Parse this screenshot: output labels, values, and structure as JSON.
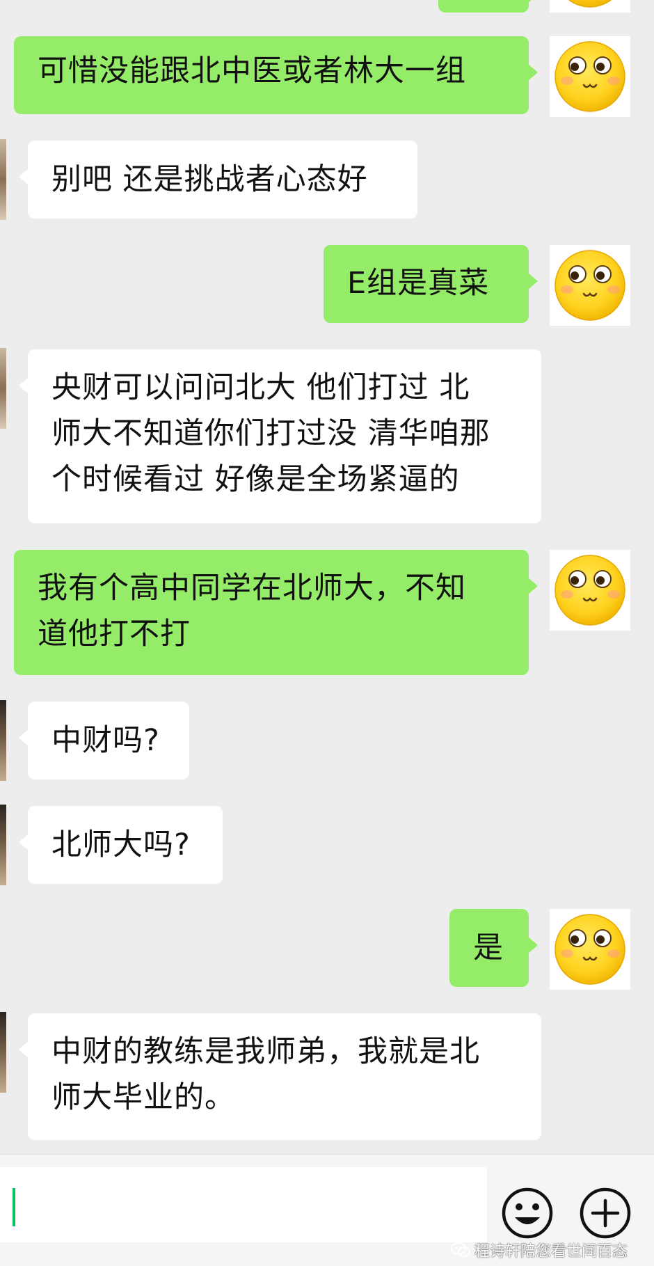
{
  "messages": [
    {
      "side": "sent",
      "text": "可惜没能跟北中医或者林大一组"
    },
    {
      "side": "received",
      "text": "别吧 还是挑战者心态好"
    },
    {
      "side": "sent",
      "text": "E组是真菜"
    },
    {
      "side": "received",
      "lines": [
        "央财可以问问北大 他们打过 北",
        "师大不知道你们打过没 清华咱那",
        "个时候看过 好像是全场紧逼的"
      ]
    },
    {
      "side": "sent",
      "lines": [
        "我有个高中同学在北师大，不知",
        "道他打不打"
      ]
    },
    {
      "side": "received",
      "text": "中财吗?"
    },
    {
      "side": "received",
      "text": "北师大吗?"
    },
    {
      "side": "sent",
      "text": "是"
    },
    {
      "side": "received",
      "lines": [
        "中财的教练是我师弟，我就是北",
        "师大毕业的。"
      ]
    }
  ],
  "input_bar": {
    "input_value": "",
    "emoji_icon": "smiley-face-icon",
    "plus_icon": "plus-circle-icon"
  },
  "watermark": {
    "text": "程诗轩陪您看世间百态",
    "icon": "wechat-official-account-icon"
  },
  "colors": {
    "chat_background": "#ededed",
    "sent_bubble": "#95ec69",
    "received_bubble": "#ffffff",
    "cursor": "#07c160"
  }
}
